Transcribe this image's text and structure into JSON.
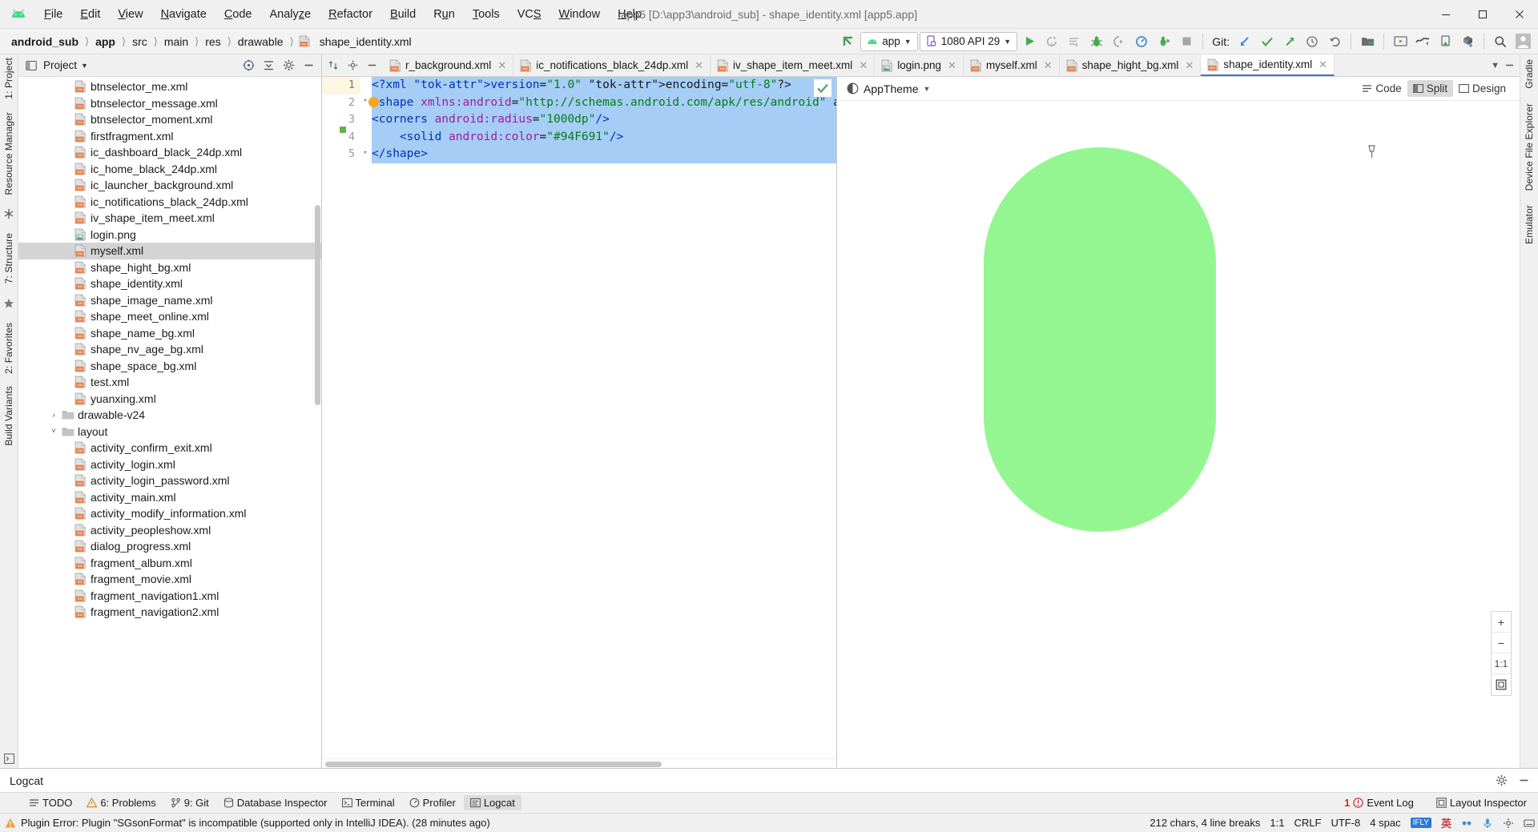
{
  "window": {
    "title": "app5 [D:\\app3\\android_sub] - shape_identity.xml [app5.app]",
    "minimize": "minimize-icon",
    "maximize": "maximize-icon",
    "close": "close-icon"
  },
  "menubar": [
    {
      "label": "File"
    },
    {
      "label": "Edit"
    },
    {
      "label": "View"
    },
    {
      "label": "Navigate"
    },
    {
      "label": "Code"
    },
    {
      "label": "Analyze"
    },
    {
      "label": "Refactor"
    },
    {
      "label": "Build"
    },
    {
      "label": "Run"
    },
    {
      "label": "Tools"
    },
    {
      "label": "VCS"
    },
    {
      "label": "Window"
    },
    {
      "label": "Help"
    }
  ],
  "breadcrumb": [
    {
      "label": "android_sub",
      "bold": true
    },
    {
      "label": "app",
      "bold": true
    },
    {
      "label": "src",
      "bold": false
    },
    {
      "label": "main",
      "bold": false
    },
    {
      "label": "res",
      "bold": false
    },
    {
      "label": "drawable",
      "bold": false
    },
    {
      "label": "shape_identity.xml",
      "bold": false
    }
  ],
  "toolbar": {
    "module_selector": "app",
    "device_selector": "1080 API 29",
    "git_label": "Git:",
    "run_tooltip": "Run",
    "debug_tooltip": "Debug"
  },
  "project_panel": {
    "title": "Project",
    "tree": [
      {
        "label": "btnselector_me.xml",
        "icon": "xml-file-icon",
        "indent": 4,
        "twisty": "",
        "selected": false
      },
      {
        "label": "btnselector_message.xml",
        "icon": "xml-file-icon",
        "indent": 4,
        "twisty": "",
        "selected": false
      },
      {
        "label": "btnselector_moment.xml",
        "icon": "xml-file-icon",
        "indent": 4,
        "twisty": "",
        "selected": false
      },
      {
        "label": "firstfragment.xml",
        "icon": "xml-file-icon",
        "indent": 4,
        "twisty": "",
        "selected": false
      },
      {
        "label": "ic_dashboard_black_24dp.xml",
        "icon": "xml-file-icon",
        "indent": 4,
        "twisty": "",
        "selected": false
      },
      {
        "label": "ic_home_black_24dp.xml",
        "icon": "xml-file-icon",
        "indent": 4,
        "twisty": "",
        "selected": false
      },
      {
        "label": "ic_launcher_background.xml",
        "icon": "xml-file-icon",
        "indent": 4,
        "twisty": "",
        "selected": false
      },
      {
        "label": "ic_notifications_black_24dp.xml",
        "icon": "xml-file-icon",
        "indent": 4,
        "twisty": "",
        "selected": false
      },
      {
        "label": "iv_shape_item_meet.xml",
        "icon": "xml-file-icon",
        "indent": 4,
        "twisty": "",
        "selected": false
      },
      {
        "label": "login.png",
        "icon": "png-file-icon",
        "indent": 4,
        "twisty": "",
        "selected": false
      },
      {
        "label": "myself.xml",
        "icon": "xml-file-icon",
        "indent": 4,
        "twisty": "",
        "selected": true
      },
      {
        "label": "shape_hight_bg.xml",
        "icon": "xml-file-icon",
        "indent": 4,
        "twisty": "",
        "selected": false
      },
      {
        "label": "shape_identity.xml",
        "icon": "xml-file-icon",
        "indent": 4,
        "twisty": "",
        "selected": false
      },
      {
        "label": "shape_image_name.xml",
        "icon": "xml-file-icon",
        "indent": 4,
        "twisty": "",
        "selected": false
      },
      {
        "label": "shape_meet_online.xml",
        "icon": "xml-file-icon",
        "indent": 4,
        "twisty": "",
        "selected": false
      },
      {
        "label": "shape_name_bg.xml",
        "icon": "xml-file-icon",
        "indent": 4,
        "twisty": "",
        "selected": false
      },
      {
        "label": "shape_nv_age_bg.xml",
        "icon": "xml-file-icon",
        "indent": 4,
        "twisty": "",
        "selected": false
      },
      {
        "label": "shape_space_bg.xml",
        "icon": "xml-file-icon",
        "indent": 4,
        "twisty": "",
        "selected": false
      },
      {
        "label": "test.xml",
        "icon": "xml-file-icon",
        "indent": 4,
        "twisty": "",
        "selected": false
      },
      {
        "label": "yuanxing.xml",
        "icon": "xml-file-icon",
        "indent": 4,
        "twisty": "",
        "selected": false
      },
      {
        "label": "drawable-v24",
        "icon": "folder-icon",
        "indent": 3,
        "twisty": "collapsed",
        "selected": false
      },
      {
        "label": "layout",
        "icon": "folder-icon",
        "indent": 3,
        "twisty": "expanded",
        "selected": false
      },
      {
        "label": "activity_confirm_exit.xml",
        "icon": "xml-file-icon",
        "indent": 4,
        "twisty": "",
        "selected": false
      },
      {
        "label": "activity_login.xml",
        "icon": "xml-file-icon",
        "indent": 4,
        "twisty": "",
        "selected": false
      },
      {
        "label": "activity_login_password.xml",
        "icon": "xml-file-icon",
        "indent": 4,
        "twisty": "",
        "selected": false
      },
      {
        "label": "activity_main.xml",
        "icon": "xml-file-icon",
        "indent": 4,
        "twisty": "",
        "selected": false
      },
      {
        "label": "activity_modify_information.xml",
        "icon": "xml-file-icon",
        "indent": 4,
        "twisty": "",
        "selected": false
      },
      {
        "label": "activity_peopleshow.xml",
        "icon": "xml-file-icon",
        "indent": 4,
        "twisty": "",
        "selected": false
      },
      {
        "label": "dialog_progress.xml",
        "icon": "xml-file-icon",
        "indent": 4,
        "twisty": "",
        "selected": false
      },
      {
        "label": "fragment_album.xml",
        "icon": "xml-file-icon",
        "indent": 4,
        "twisty": "",
        "selected": false
      },
      {
        "label": "fragment_movie.xml",
        "icon": "xml-file-icon",
        "indent": 4,
        "twisty": "",
        "selected": false
      },
      {
        "label": "fragment_navigation1.xml",
        "icon": "xml-file-icon",
        "indent": 4,
        "twisty": "",
        "selected": false
      },
      {
        "label": "fragment_navigation2.xml",
        "icon": "xml-file-icon",
        "indent": 4,
        "twisty": "",
        "selected": false
      }
    ]
  },
  "left_rail": [
    {
      "label": "1: Project",
      "name": "tool-window-project"
    },
    {
      "label": "Resource Manager",
      "name": "tool-window-resource-manager"
    },
    {
      "label": "7: Structure",
      "name": "tool-window-structure"
    },
    {
      "label": "2: Favorites",
      "name": "tool-window-favorites"
    },
    {
      "label": "Build Variants",
      "name": "tool-window-build-variants"
    }
  ],
  "right_rail": [
    {
      "label": "Gradle",
      "name": "tool-window-gradle"
    },
    {
      "label": "Device File Explorer",
      "name": "tool-window-device-file-explorer"
    },
    {
      "label": "Emulator",
      "name": "tool-window-emulator"
    }
  ],
  "editor_tabs": [
    {
      "label": "r_background.xml",
      "icon": "xml-file-icon",
      "active": false
    },
    {
      "label": "ic_notifications_black_24dp.xml",
      "icon": "xml-file-icon",
      "active": false
    },
    {
      "label": "iv_shape_item_meet.xml",
      "icon": "xml-file-icon",
      "active": false
    },
    {
      "label": "login.png",
      "icon": "png-file-icon",
      "active": false
    },
    {
      "label": "myself.xml",
      "icon": "xml-file-icon",
      "active": false
    },
    {
      "label": "shape_hight_bg.xml",
      "icon": "xml-file-icon",
      "active": false
    },
    {
      "label": "shape_identity.xml",
      "icon": "xml-file-icon",
      "active": true
    }
  ],
  "view_switch": {
    "code": "Code",
    "split": "Split",
    "design": "Design",
    "active": "Split"
  },
  "editor": {
    "lines": [
      {
        "num": "1",
        "text": "<?xml version=\"1.0\" encoding=\"utf-8\"?>"
      },
      {
        "num": "2",
        "text": "<shape xmlns:android=\"http://schemas.android.com/apk/res/android\" androi"
      },
      {
        "num": "3",
        "text": "<corners android:radius=\"1000dp\"/>"
      },
      {
        "num": "4",
        "text": "    <solid android:color=\"#94F691\"/>"
      },
      {
        "num": "5",
        "text": "</shape>"
      }
    ],
    "inspection_status": "no-errors-check-icon"
  },
  "preview": {
    "theme": "AppTheme",
    "shape_color": "#94F691",
    "corner_radius": "1000dp",
    "zoom_in": "+",
    "zoom_out": "−",
    "zoom_actual": "1:1",
    "zoom_fit": "fit-icon"
  },
  "logcat": {
    "title": "Logcat",
    "settings_icon": "gear-icon",
    "hide_icon": "hide-icon"
  },
  "tool_window_bar": {
    "items": [
      {
        "label": "TODO",
        "icon": "todo-icon",
        "active": false
      },
      {
        "label": "6: Problems",
        "icon": "problems-icon",
        "active": false
      },
      {
        "label": "9: Git",
        "icon": "git-icon",
        "active": false
      },
      {
        "label": "Database Inspector",
        "icon": "database-icon",
        "active": false
      },
      {
        "label": "Terminal",
        "icon": "terminal-icon",
        "active": false
      },
      {
        "label": "Profiler",
        "icon": "profiler-icon",
        "active": false
      },
      {
        "label": "Logcat",
        "icon": "logcat-icon",
        "active": true
      }
    ],
    "right": [
      {
        "label": "Event Log",
        "icon": "event-log-icon",
        "badge": "1"
      },
      {
        "label": "Layout Inspector",
        "icon": "layout-inspector-icon",
        "badge": ""
      }
    ]
  },
  "statusbar": {
    "message": "Plugin Error: Plugin \"SGsonFormat\" is incompatible (supported only in IntelliJ IDEA). (28 minutes ago)",
    "chars": "212 chars, 4 line breaks",
    "caret": "1:1",
    "line_separator": "CRLF",
    "encoding": "UTF-8",
    "indent": "4 spac",
    "ime_label": "IFLY",
    "ime_lang": "英"
  }
}
